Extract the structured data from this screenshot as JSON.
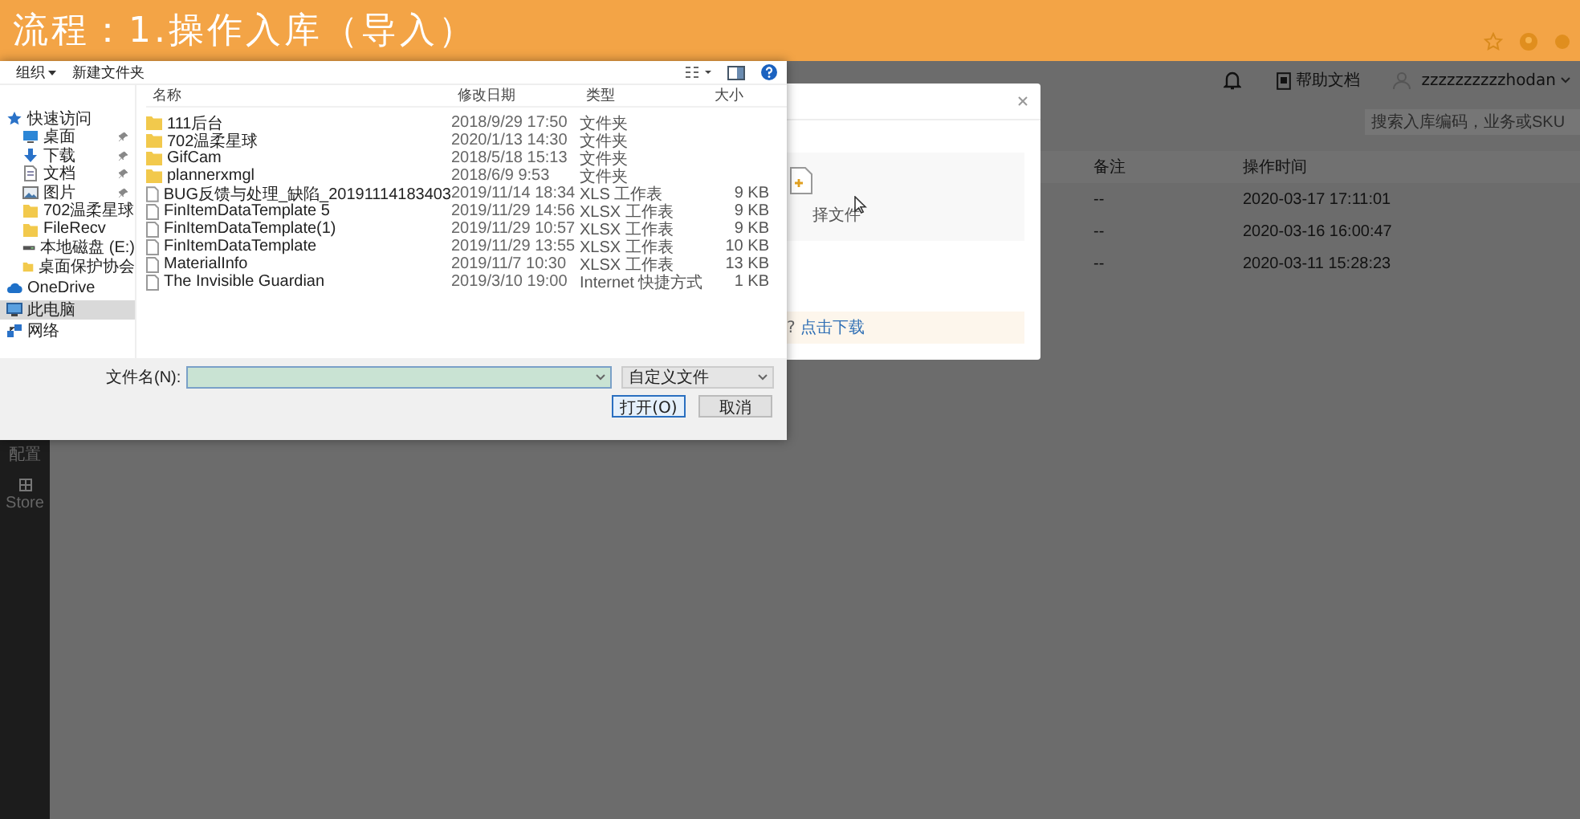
{
  "banner": {
    "title": "流程：1.操作入库（导入）"
  },
  "header": {
    "help": "帮助文档",
    "user": "zzzzzzzzzzhodan"
  },
  "search": {
    "placeholder": "搜索入库编码，业务或SKU"
  },
  "sidebar": {
    "items": [
      {
        "label": "配置",
        "kind": "plain"
      },
      {
        "label": "Store",
        "kind": "grid"
      }
    ]
  },
  "table": {
    "columns": [
      "备注",
      "操作时间"
    ],
    "rows": [
      {
        "note": "--",
        "time": "2020-03-17 17:11:01"
      },
      {
        "note": "--",
        "time": "2020-03-16 16:00:47"
      },
      {
        "note": "--",
        "time": "2020-03-11 15:28:23"
      }
    ]
  },
  "modal": {
    "upload_text": "择文件",
    "hint_tail": "?",
    "link": "点击下载"
  },
  "file_dialog": {
    "organize": "组织",
    "new_folder": "新建文件夹",
    "columns": [
      "名称",
      "修改日期",
      "类型",
      "大小"
    ],
    "nav": [
      {
        "label": "快速访问",
        "kind": "star",
        "pinned": false,
        "selected": false
      },
      {
        "label": "桌面",
        "kind": "desktop",
        "pinned": true,
        "selected": false
      },
      {
        "label": "下载",
        "kind": "download",
        "pinned": true,
        "selected": false
      },
      {
        "label": "文档",
        "kind": "document",
        "pinned": true,
        "selected": false
      },
      {
        "label": "图片",
        "kind": "picture",
        "pinned": true,
        "selected": false
      },
      {
        "label": "702温柔星球",
        "kind": "folder",
        "pinned": false,
        "selected": false
      },
      {
        "label": "FileRecv",
        "kind": "folder",
        "pinned": false,
        "selected": false
      },
      {
        "label": "本地磁盘 (E:)",
        "kind": "drive",
        "pinned": false,
        "selected": false
      },
      {
        "label": "桌面保护协会",
        "kind": "folder",
        "pinned": false,
        "selected": false
      },
      {
        "label": "OneDrive",
        "kind": "cloud",
        "pinned": false,
        "selected": false
      },
      {
        "label": "此电脑",
        "kind": "pc",
        "pinned": false,
        "selected": true
      },
      {
        "label": "网络",
        "kind": "network",
        "pinned": false,
        "selected": false
      }
    ],
    "files": [
      {
        "name": "111后台",
        "date": "2018/9/29 17:50",
        "type": "文件夹",
        "kind": "folder"
      },
      {
        "name": "702温柔星球",
        "date": "2020/1/13 14:30",
        "type": "文件夹",
        "kind": "folder"
      },
      {
        "name": "GifCam",
        "date": "2018/5/18 15:13",
        "type": "文件夹",
        "kind": "folder"
      },
      {
        "name": "plannerxmgl",
        "date": "2018/6/9 9:53",
        "type": "文件夹",
        "kind": "folder"
      },
      {
        "name": "BUG反馈与处理_缺陷_20191114183403",
        "date": "2019/11/14 18:34",
        "type": "XLS 工作表",
        "size": "9 KB",
        "kind": "file"
      },
      {
        "name": "FinItemDataTemplate 5",
        "date": "2019/11/29 14:56",
        "type": "XLSX 工作表",
        "size": "9 KB",
        "kind": "file"
      },
      {
        "name": "FinItemDataTemplate(1)",
        "date": "2019/11/29 10:57",
        "type": "XLSX 工作表",
        "size": "9 KB",
        "kind": "file"
      },
      {
        "name": "FinItemDataTemplate",
        "date": "2019/11/29 13:55",
        "type": "XLSX 工作表",
        "size": "10 KB",
        "kind": "file"
      },
      {
        "name": "MaterialInfo",
        "date": "2019/11/7 10:30",
        "type": "XLSX 工作表",
        "size": "13 KB",
        "kind": "file"
      },
      {
        "name": "The Invisible Guardian",
        "date": "2019/3/10 19:00",
        "type": "Internet 快捷方式",
        "size": "1 KB",
        "kind": "file"
      }
    ],
    "filename_label": "文件名(N):",
    "filter": "自定义文件",
    "buttons": [
      "打开(O)",
      "取消"
    ]
  }
}
